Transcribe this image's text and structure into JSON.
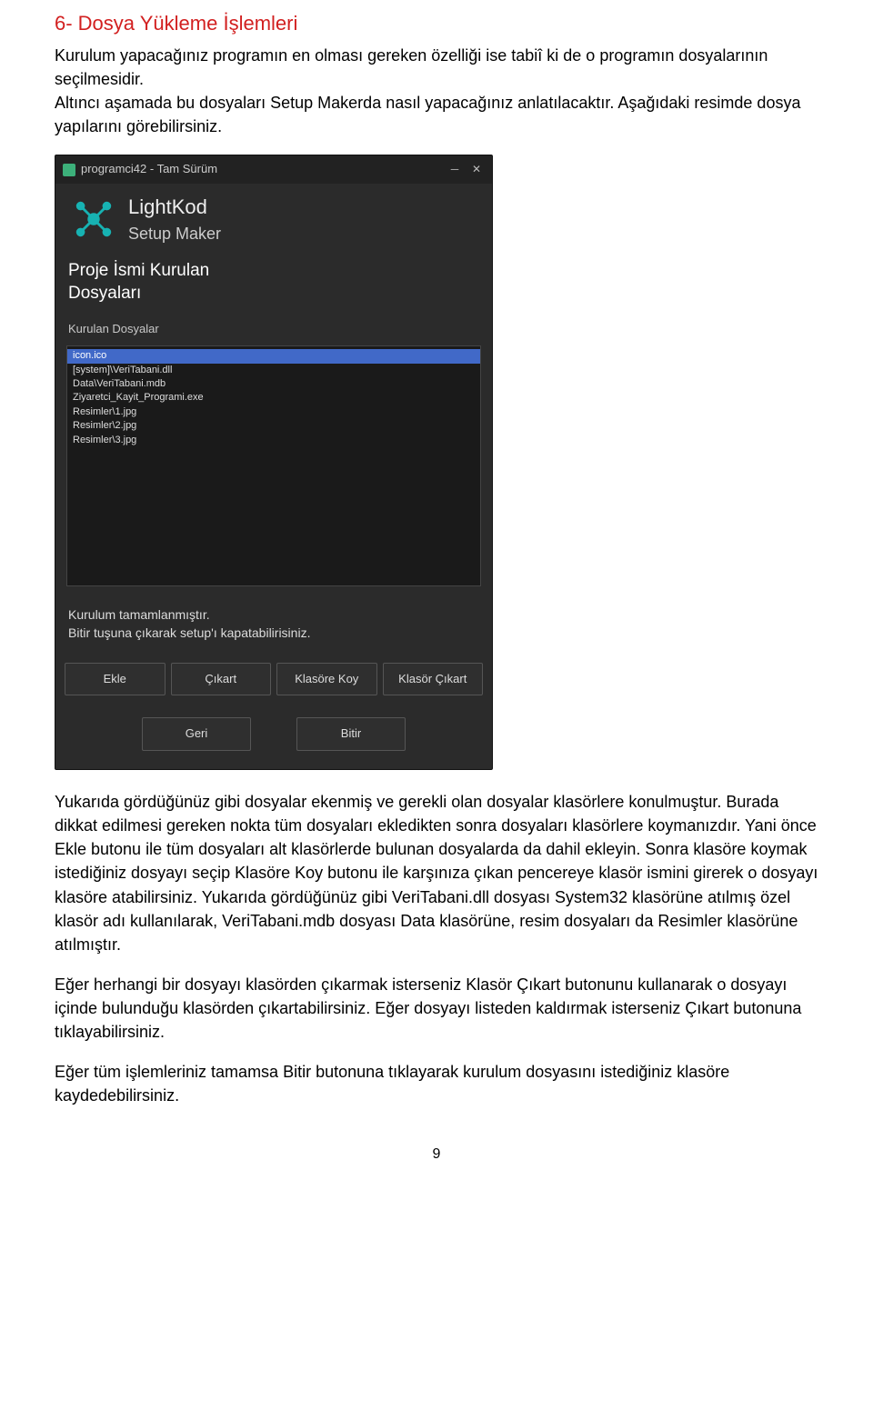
{
  "doc": {
    "heading": "6- Dosya Yükleme İşlemleri",
    "intro": "Kurulum yapacağınız programın en olması gereken özelliği ise tabiî ki de o programın dosyalarının seçilmesidir.",
    "intro2": "Altıncı aşamada bu dosyaları Setup Makerda nasıl yapacağınız anlatılacaktır. Aşağıdaki resimde dosya yapılarını görebilirsiniz.",
    "para_after1": "Yukarıda gördüğünüz gibi dosyalar ekenmiş ve gerekli olan dosyalar klasörlere konulmuştur. Burada dikkat edilmesi gereken nokta tüm dosyaları ekledikten sonra dosyaları klasörlere koymanızdır. Yani önce Ekle butonu ile tüm dosyaları alt klasörlerde bulunan dosyalarda da dahil ekleyin. Sonra klasöre koymak istediğiniz dosyayı seçip Klasöre Koy butonu ile karşınıza çıkan pencereye klasör ismini girerek o dosyayı klasöre atabilirsiniz. Yukarıda gördüğünüz gibi VeriTabani.dll dosyası System32 klasörüne atılmış özel klasör adı kullanılarak, VeriTabani.mdb dosyası Data klasörüne, resim dosyaları da Resimler klasörüne atılmıştır.",
    "para_after2": "Eğer herhangi bir dosyayı klasörden çıkarmak isterseniz Klasör Çıkart butonunu kullanarak o dosyayı içinde bulunduğu klasörden çıkartabilirsiniz. Eğer dosyayı listeden kaldırmak isterseniz Çıkart butonuna tıklayabilirsiniz.",
    "para_after3": "Eğer tüm işlemleriniz tamamsa Bitir butonuna tıklayarak kurulum dosyasını istediğiniz klasöre kaydedebilirsiniz.",
    "page_number": "9"
  },
  "app": {
    "title": "programci42 - Tam Sürüm",
    "brand_name": "LightKod",
    "brand_sub": "Setup Maker",
    "project_title_l1": "Proje İsmi Kurulan",
    "project_title_l2": "Dosyaları",
    "list_label": "Kurulan Dosyalar",
    "files": [
      "icon.ico",
      "[system]\\VeriTabani.dll",
      "Data\\VeriTabani.mdb",
      "Ziyaretci_Kayit_Programi.exe",
      "Resimler\\1.jpg",
      "Resimler\\2.jpg",
      "Resimler\\3.jpg"
    ],
    "status_l1": "Kurulum tamamlanmıştır.",
    "status_l2": "Bitir tuşuna çıkarak setup'ı kapatabilirisiniz.",
    "buttons_row1": {
      "ekle": "Ekle",
      "cikart": "Çıkart",
      "klasore": "Klasöre Koy",
      "klasor_cikart": "Klasör Çıkart"
    },
    "buttons_row2": {
      "geri": "Geri",
      "bitir": "Bitir"
    }
  }
}
